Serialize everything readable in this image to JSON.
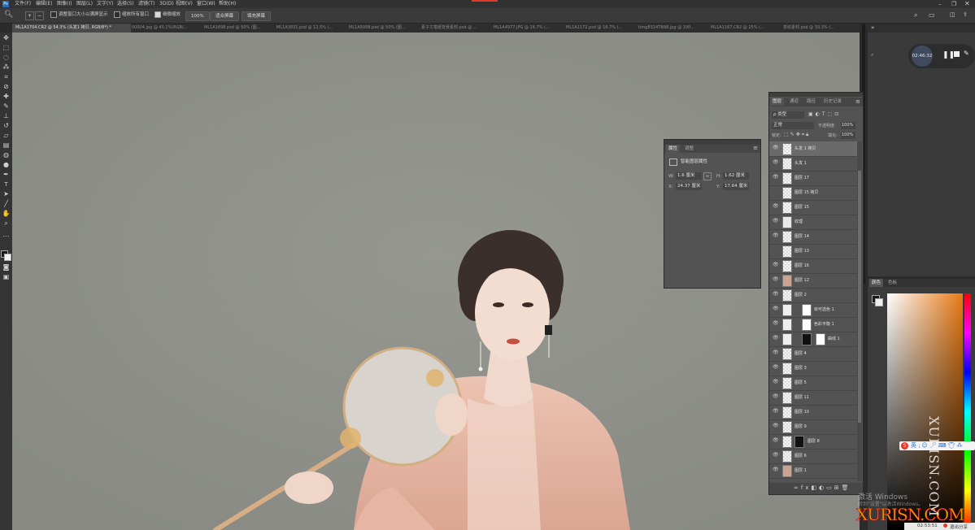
{
  "menu": [
    "文件(F)",
    "编辑(E)",
    "图像(I)",
    "图层(L)",
    "文字(Y)",
    "选择(S)",
    "滤镜(T)",
    "3D(D)",
    "视图(V)",
    "窗口(W)",
    "帮助(H)"
  ],
  "options": {
    "resize_windows": "调整窗口大小以满屏显示",
    "zoom_all": "缩放所有窗口",
    "scrubby_zoom": "细微缩放",
    "zoom_value": "100%",
    "fit_screen": "适合屏幕",
    "fill_screen": "填充屏幕"
  },
  "doc_tabs": [
    "ML1A1704.CR2 @ 54.3% (头发1 拷贝, RGB/8*) *",
    "00004.jpg @ 40.1%(RGB/...",
    "ML1A1698.psd @ 50% (图...",
    "ML1A3831.psd @ 12.5% (...",
    "ML1A5008.psd @ 50% (图...",
    "素子工笔纸背景素材.psd @ ...",
    "ML1A4977.JPG @ 16.7% (...",
    "ML1A1172.psd @ 16.7% (...",
    "timg8324T8N8.jpg @ 100...",
    "ML1A1167.CR2 @ 25% (...",
    "茶纹素材.psd @ 33.3% (..."
  ],
  "props": {
    "tab_props": "属性",
    "tab_adjust": "调整",
    "section": "智能图层属性",
    "w_label": "W:",
    "w_value": "1.6 厘米",
    "h_label": "H:",
    "h_value": "1.62 厘米",
    "x_label": "X:",
    "x_value": "24.37 厘米",
    "y_label": "Y:",
    "y_value": "17.64 厘米"
  },
  "layers_panel": {
    "tabs": [
      "图层",
      "通道",
      "路径",
      "历史记录"
    ],
    "filter": "ρ 类型",
    "blend_mode": "正常",
    "opacity_label": "不透明度:",
    "opacity": "100%",
    "lock_label": "锁定:",
    "fill_label": "填充:",
    "fill": "100%",
    "layers": [
      {
        "name": "头发 1 拷贝",
        "selected": true
      },
      {
        "name": "头发 1"
      },
      {
        "name": "图层 17"
      },
      {
        "name": "图层 15 拷贝"
      },
      {
        "name": "图层 15"
      },
      {
        "name": "纹理"
      },
      {
        "name": "图层 14"
      },
      {
        "name": "图层 13"
      },
      {
        "name": "图层 16"
      },
      {
        "name": "图层 12"
      },
      {
        "name": "图层 2"
      },
      {
        "name": "目可选色 1"
      },
      {
        "name": "色彩平衡 1"
      },
      {
        "name": "曲线 1"
      },
      {
        "name": "图层 4"
      },
      {
        "name": "图层 3"
      },
      {
        "name": "图层 5"
      },
      {
        "name": "图层 11"
      },
      {
        "name": "图层 10"
      },
      {
        "name": "图层 9"
      },
      {
        "name": "图层 8"
      },
      {
        "name": "图层 6"
      },
      {
        "name": "图层 1"
      }
    ]
  },
  "recorder": {
    "time": "02:46:32"
  },
  "color_panel": {
    "tab_color": "颜色",
    "tab_swatches": "色板"
  },
  "watermark": {
    "windows": "激活 Windows",
    "windows_sub": "转到\"设置\"以激活Windows。",
    "site": "XURISN.COM",
    "vertical": "XURISN.COM"
  },
  "taskbar": {
    "time": "02:53:51",
    "exit": "退出分享"
  },
  "colors": {
    "canvas": "#8f918a",
    "panel": "#535353",
    "accent_red": "#e23a2a",
    "gold": "#e0b000"
  }
}
